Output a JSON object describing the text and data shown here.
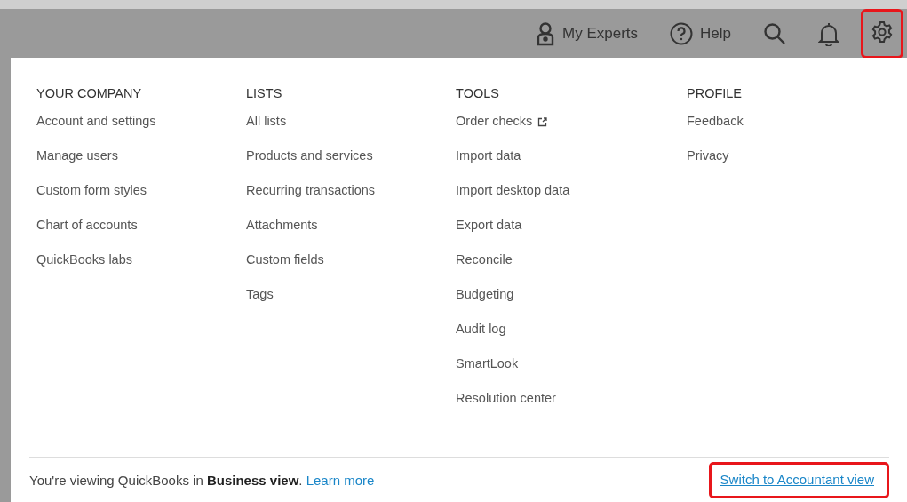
{
  "top_bar": {
    "items": [
      {
        "kind": "experts",
        "label": "My Experts",
        "highlighted": false
      },
      {
        "kind": "help",
        "label": "Help",
        "highlighted": false
      },
      {
        "kind": "search",
        "highlighted": false
      },
      {
        "kind": "bell",
        "highlighted": false
      },
      {
        "kind": "gear",
        "highlighted": true
      }
    ]
  },
  "menu": {
    "columns": [
      {
        "heading": "YOUR COMPANY",
        "items": [
          {
            "label": "Account and settings"
          },
          {
            "label": "Manage users"
          },
          {
            "label": "Custom form styles"
          },
          {
            "label": "Chart of accounts"
          },
          {
            "label": "QuickBooks labs"
          }
        ]
      },
      {
        "heading": "LISTS",
        "items": [
          {
            "label": "All lists"
          },
          {
            "label": "Products and services"
          },
          {
            "label": "Recurring transactions"
          },
          {
            "label": "Attachments"
          },
          {
            "label": "Custom fields"
          },
          {
            "label": "Tags"
          }
        ]
      },
      {
        "heading": "TOOLS",
        "items": [
          {
            "label": "Order checks",
            "external": true
          },
          {
            "label": "Import data"
          },
          {
            "label": "Import desktop data"
          },
          {
            "label": "Export data"
          },
          {
            "label": "Reconcile"
          },
          {
            "label": "Budgeting"
          },
          {
            "label": "Audit log"
          },
          {
            "label": "SmartLook"
          },
          {
            "label": "Resolution center"
          }
        ]
      },
      {
        "heading": "PROFILE",
        "items": [
          {
            "label": "Feedback"
          },
          {
            "label": "Privacy"
          }
        ]
      }
    ]
  },
  "footer": {
    "message": "You're viewing QuickBooks in **Business view**.",
    "learn_more": "Learn more",
    "switch_link": "Switch to Accountant view",
    "switch_highlighted": true
  }
}
